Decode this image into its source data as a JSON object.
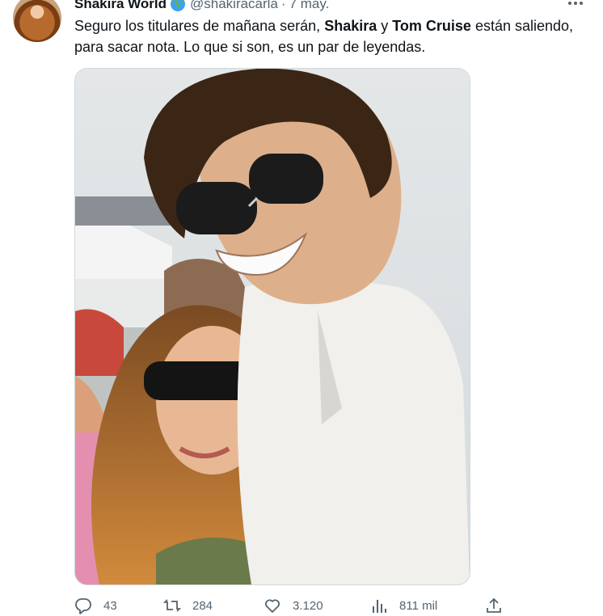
{
  "tweet": {
    "author_name": "Shakira World",
    "author_handle": "@shakiracarla",
    "separator": "·",
    "time": "7 may.",
    "text_part1": "Seguro los titulares de mañana serán, ",
    "bold1": "Shakira",
    "text_part2": " y ",
    "bold2": "Tom Cruise",
    "text_part3": " están saliendo, para sacar nota. Lo que si son, es un par de leyendas.",
    "verified_icon": "earth-globe-icon",
    "more_icon": "more-dots-icon"
  },
  "stats": {
    "replies": "43",
    "retweets": "284",
    "likes": "3.120",
    "views": "811 mil",
    "reply_icon": "reply-icon",
    "retweet_icon": "retweet-icon",
    "like_icon": "heart-icon",
    "views_icon": "views-chart-icon",
    "share_icon": "share-icon"
  },
  "colors": {
    "text": "#0f1419",
    "secondary": "#536471",
    "border": "#cfd9de"
  }
}
